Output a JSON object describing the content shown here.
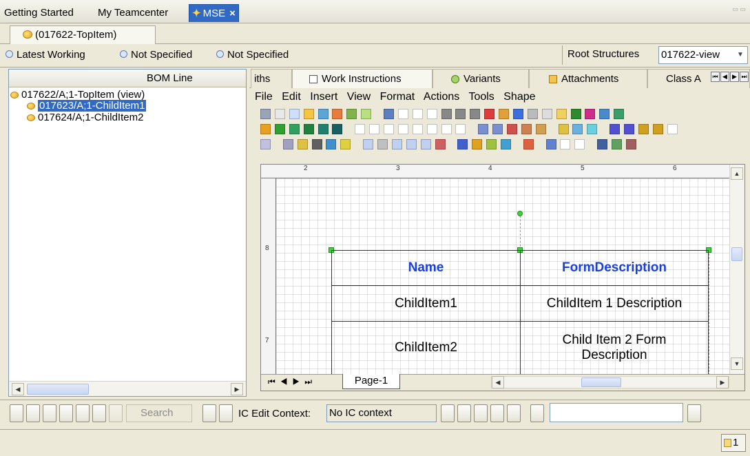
{
  "tabs": [
    {
      "label": "Getting Started"
    },
    {
      "label": "My Teamcenter"
    },
    {
      "label": "MSE",
      "active": true
    }
  ],
  "close_glyph": "×",
  "subtab": {
    "label": "(017622-TopItem)"
  },
  "revision": {
    "rule1": "Latest Working",
    "rule2": "Not Specified",
    "rule3": "Not Specified",
    "root_label": "Root Structures",
    "root_value": "017622-view"
  },
  "bom": {
    "header": "BOM Line",
    "nodes": [
      {
        "label": "017622/A;1-TopItem (view)"
      },
      {
        "label": "017623/A;1-ChildItem1",
        "selected": true
      },
      {
        "label": "017624/A;1-ChildItem2"
      }
    ]
  },
  "right_tabs": [
    {
      "label": "iths",
      "icon": "paths-icon"
    },
    {
      "label": "Work Instructions",
      "icon": "document-icon",
      "active": true
    },
    {
      "label": "Variants",
      "icon": "variants-icon"
    },
    {
      "label": "Attachments",
      "icon": "attachment-icon"
    },
    {
      "label": "Class A",
      "icon": "class-icon"
    }
  ],
  "menu": [
    "File",
    "Edit",
    "Insert",
    "View",
    "Format",
    "Actions",
    "Tools",
    "Shape"
  ],
  "ruler": {
    "top_numbers": [
      "2",
      "3",
      "4",
      "5",
      "6"
    ],
    "left_numbers": [
      "8",
      "7"
    ]
  },
  "table": {
    "headers": [
      "Name",
      "FormDescription"
    ],
    "rows": [
      [
        "ChildItem1",
        "ChildItem 1 Description"
      ],
      [
        "ChildItem2",
        "Child Item 2 Form Description"
      ]
    ]
  },
  "page_tab": "Page-1",
  "bottom": {
    "search_label": "Search",
    "ic_label": "IC Edit Context:",
    "ic_value": "No IC context"
  },
  "status": {
    "count": "1"
  },
  "colors": {
    "selection": "#316ac5",
    "header_text": "#1a3fe0",
    "handle": "#3fd23f"
  }
}
